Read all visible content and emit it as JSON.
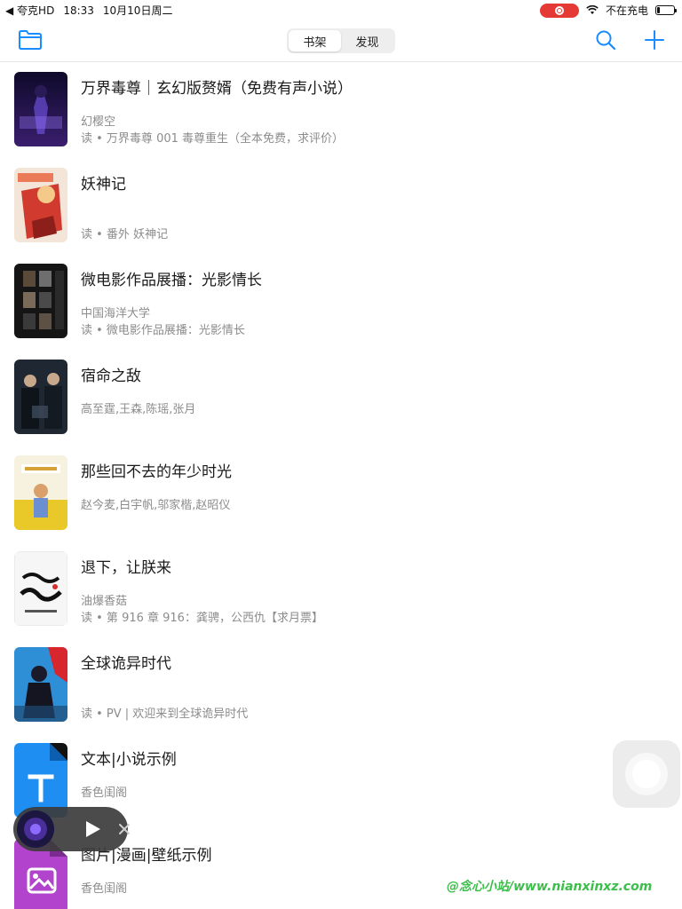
{
  "status_bar": {
    "back_app": "◀ 夸克HD",
    "time": "18:33",
    "date": "10月10日周二",
    "charging_text": "不在充电",
    "battery_level": 0.15,
    "record_color": "#e53935"
  },
  "nav": {
    "folder_icon": "folder-icon",
    "tabs": [
      {
        "label": "书架",
        "active": true
      },
      {
        "label": "发现",
        "active": false
      }
    ],
    "accent_color": "#1a8cff"
  },
  "books": [
    {
      "title": "万界毒尊｜玄幻版赘婿（免费有声小说）",
      "author": "幻樱空",
      "progress": "读 • 万界毒尊 001 毒尊重生（全本免费，求评价）",
      "cover": "dark-purple"
    },
    {
      "title": "妖神记",
      "author": "",
      "progress": "读 • 番外 妖神记",
      "cover": "red-anime"
    },
    {
      "title": "微电影作品展播：光影情长",
      "author": "中国海洋大学",
      "progress": "读 • 微电影作品展播：光影情长",
      "cover": "dark-grid"
    },
    {
      "title": "宿命之敌",
      "author": "高至霆,王森,陈瑶,张月",
      "progress": "",
      "cover": "dark-poster"
    },
    {
      "title": "那些回不去的年少时光",
      "author": "赵今麦,白宇帆,邬家楷,赵昭仪",
      "progress": "",
      "cover": "yellow-field"
    },
    {
      "title": "退下，让朕来",
      "author": "油爆香菇",
      "progress": "读 • 第 916 章 916：龚骋，公西仇【求月票】",
      "cover": "white-calligraphy"
    },
    {
      "title": "全球诡异时代",
      "author": "",
      "progress": "读 • PV | 欢迎来到全球诡异时代",
      "cover": "blue-red-figure"
    },
    {
      "title": "文本|小说示例",
      "author": "香色闺阁",
      "progress": "",
      "cover": "blue-text-doc"
    },
    {
      "title": "图片|漫画|壁纸示例",
      "author": "香色闺阁",
      "progress": "",
      "cover": "purple-image-doc"
    }
  ],
  "player": {
    "play_icon": "play-icon",
    "close_icon": "close-icon"
  },
  "watermark": "@念心小站/www.nianxinxz.com"
}
